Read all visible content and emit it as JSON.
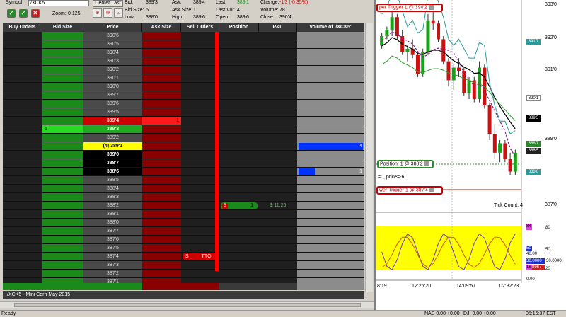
{
  "header": {
    "symbol_label": "Symbol:",
    "symbol_value": "/XCK5",
    "center_last": "Center Last",
    "zoom_label": "Zoom:",
    "zoom_value": "0.125",
    "bid_label": "Bid:",
    "bid_value": "389'3",
    "bidsize_label": "Bid Size:",
    "bidsize_value": "5",
    "low_label": "Low:",
    "low_value": "388'0",
    "ask_label": "Ask:",
    "ask_value": "389'4",
    "asksize_label": "Ask Size:",
    "asksize_value": "1",
    "high_label": "High:",
    "high_value": "389'6",
    "last_label": "Last:",
    "last_value": "389'1",
    "lastvol_label": "Last Vol:",
    "lastvol_value": "4",
    "open_label": "Open:",
    "open_value": "389'6",
    "change_label": "Change:",
    "change_value": "-1'3 (-0.35%)",
    "volume_label": "Volume:",
    "volume_value": "78",
    "close_label": "Close:",
    "close_value": "390'4"
  },
  "columns": [
    "Buy Orders",
    "Bid Size",
    "Price",
    "Ask Size",
    "Sell Orders",
    "Position",
    "P&L",
    "Volume of '/XCK5'"
  ],
  "rows": [
    {
      "price": "390'6"
    },
    {
      "price": "390'5"
    },
    {
      "price": "390'4"
    },
    {
      "price": "390'3"
    },
    {
      "price": "390'2"
    },
    {
      "price": "390'1"
    },
    {
      "price": "390'0"
    },
    {
      "price": "389'7"
    },
    {
      "price": "389'6"
    },
    {
      "price": "389'5"
    },
    {
      "price": "389'4",
      "ask": "1",
      "kind": "ask"
    },
    {
      "price": "389'3",
      "bid": "5",
      "kind": "bid"
    },
    {
      "price": "389'2"
    },
    {
      "price": "(4)  389'1",
      "kind": "last",
      "vol": "4",
      "volfrac": 1.0
    },
    {
      "price": "389'0",
      "kind": "traded"
    },
    {
      "price": "388'7",
      "kind": "traded"
    },
    {
      "price": "388'6",
      "kind": "traded",
      "vol": "1",
      "volfrac": 0.25
    },
    {
      "price": "388'5"
    },
    {
      "price": "388'4"
    },
    {
      "price": "388'3"
    },
    {
      "price": "388'2",
      "position": "1",
      "pnl": "$ 11.25"
    },
    {
      "price": "388'1"
    },
    {
      "price": "388'0"
    },
    {
      "price": "387'7"
    },
    {
      "price": "387'6"
    },
    {
      "price": "387'5"
    },
    {
      "price": "387'4",
      "sell_order": "TTO"
    },
    {
      "price": "387'3"
    },
    {
      "price": "387'2"
    },
    {
      "price": "387'1"
    }
  ],
  "position_order_marker": "B",
  "sell_order_marker": "S",
  "footer_label": "/XCK5 - Mini Corn May 2015",
  "chart": {
    "upper_trigger": "per Trigger 1 @ 394'2",
    "lower_trigger": "wer Trigger 1 @ 387'4",
    "position_label": "Position: 1 @ 388'2",
    "price_line_label": "=0, price=-6",
    "tick_count": "Tick Count:  4",
    "y_labels": [
      "393'0",
      "392'0",
      "391'0",
      "389'0",
      "387'0"
    ],
    "price_tags": [
      "391'7",
      "390'1",
      "389'5",
      "388'7",
      "388'5",
      "388'0"
    ],
    "osc_labels": [
      "80",
      "50",
      "40.00",
      "30.0000",
      "20",
      "0.00"
    ],
    "osc_tags": [
      "84",
      "50",
      "30.0000",
      "18",
      "8967"
    ],
    "time_labels": [
      "8:19",
      "12:26:20",
      "14:09:57",
      "02:32:23"
    ],
    "candles": [
      [
        392.0,
        392.4,
        391.9,
        392.3
      ],
      [
        392.3,
        392.6,
        392.2,
        392.5
      ],
      [
        392.5,
        393.1,
        392.3,
        392.9
      ],
      [
        392.9,
        393.0,
        392.2,
        392.3
      ],
      [
        392.3,
        392.5,
        391.7,
        391.8
      ],
      [
        391.8,
        392.0,
        391.5,
        391.9
      ],
      [
        391.9,
        392.2,
        391.6,
        391.7
      ],
      [
        391.7,
        391.8,
        391.0,
        391.1
      ],
      [
        391.1,
        391.9,
        391.0,
        391.8
      ],
      [
        391.8,
        393.0,
        391.7,
        392.8
      ],
      [
        392.8,
        393.2,
        392.5,
        392.7
      ],
      [
        392.7,
        392.8,
        392.1,
        392.2
      ],
      [
        392.2,
        392.3,
        391.4,
        391.5
      ],
      [
        391.5,
        391.6,
        390.7,
        390.9
      ],
      [
        390.9,
        391.4,
        390.6,
        391.3
      ],
      [
        391.3,
        391.6,
        391.0,
        391.2
      ],
      [
        391.2,
        391.3,
        390.4,
        390.5
      ],
      [
        390.5,
        391.0,
        390.3,
        390.9
      ],
      [
        390.9,
        391.0,
        390.2,
        390.3
      ],
      [
        390.3,
        391.5,
        390.2,
        391.3
      ],
      [
        391.3,
        391.4,
        390.0,
        390.1
      ],
      [
        390.1,
        390.2,
        389.0,
        389.2
      ],
      [
        389.2,
        389.5,
        388.4,
        388.6
      ],
      [
        388.6,
        389.0,
        388.3,
        388.9
      ],
      [
        388.9,
        389.0,
        388.3,
        388.4
      ],
      [
        388.4,
        388.6,
        387.9,
        388.0
      ],
      [
        388.0,
        388.7,
        387.9,
        388.6
      ]
    ]
  },
  "status": {
    "ready": "Ready",
    "nas": "NAS 0.00  +0.00",
    "dji": "DJI 0.00  +0.00",
    "clock": "05:16:37 EST"
  },
  "colors": {
    "bid_green": "#1a8a1a",
    "ask_red": "#8a0000",
    "last_yellow": "#ffff00",
    "volume_blue": "#0033ff"
  }
}
